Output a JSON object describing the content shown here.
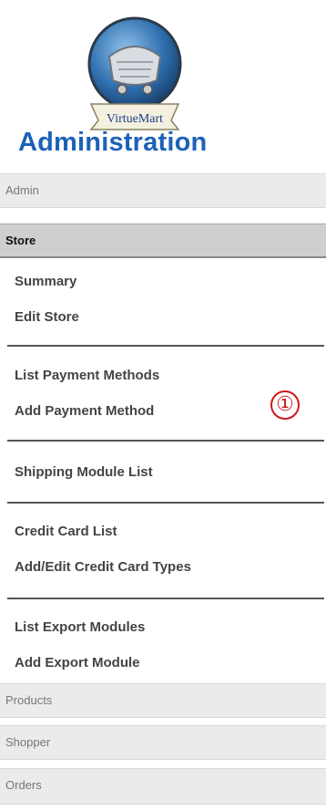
{
  "logo_text": "VirtueMart",
  "title": "Administration",
  "sections": {
    "admin": "Admin",
    "store": "Store",
    "products": "Products",
    "shopper": "Shopper",
    "orders": "Orders"
  },
  "store_links": {
    "summary": "Summary",
    "edit_store": "Edit Store",
    "list_payment_methods": "List Payment Methods",
    "add_payment_method": "Add Payment Method",
    "shipping_module_list": "Shipping Module List",
    "credit_card_list": "Credit Card List",
    "add_edit_credit_card_types": "Add/Edit Credit Card Types",
    "list_export_modules": "List Export Modules",
    "add_export_module": "Add Export Module"
  },
  "annotation_marker": "①",
  "colors": {
    "title_blue": "#1c62b8",
    "marker_red": "#d01818",
    "section_bg": "#ebebeb",
    "active_section_bg": "#cfcfcf"
  }
}
